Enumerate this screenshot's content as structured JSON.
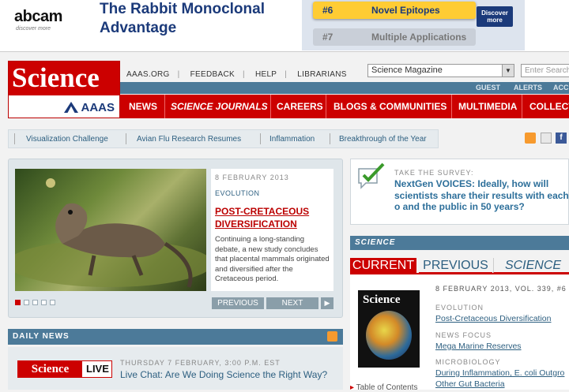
{
  "ad": {
    "brand": "abcam",
    "tagline": "discover more",
    "headline_line1": "The Rabbit Monoclonal",
    "headline_line2": "Advantage",
    "rows": [
      {
        "num": "#6",
        "text": "Novel Epitopes"
      },
      {
        "num": "#7",
        "text": "Multiple Applications"
      }
    ],
    "cta": "Discover more"
  },
  "header": {
    "logo_text": "Science",
    "aaas_text": "AAAS",
    "toplinks": [
      "AAAS.ORG",
      "FEEDBACK",
      "HELP",
      "LIBRARIANS"
    ],
    "select_value": "Science Magazine",
    "search_placeholder": "Enter Search",
    "userbar": [
      "GUEST",
      "ALERTS",
      "ACC"
    ]
  },
  "nav": [
    "NEWS",
    "SCIENCE JOURNALS",
    "CAREERS",
    "BLOGS & COMMUNITIES",
    "MULTIMEDIA",
    "COLLECT"
  ],
  "sublinks": [
    "Visualization Challenge",
    "Avian Flu Research Resumes",
    "Inflammation",
    "Breakthrough of the Year"
  ],
  "feature": {
    "date": "8 FEBRUARY 2013",
    "category": "EVOLUTION",
    "title": "POST-CRETACEOUS DIVERSIFICATION",
    "body": "Continuing a long-standing debate, a new study concludes that placental mammals originated and diversified after the Cretaceous period.",
    "prev": "PREVIOUS",
    "next": "NEXT"
  },
  "daily_news": {
    "header": "DAILY NEWS",
    "logo_science": "Science",
    "logo_live": "LIVE",
    "when": "THURSDAY 7 FEBRUARY, 3:00 P.M. EST",
    "title": "Live Chat: Are We Doing Science the Right Way?"
  },
  "survey": {
    "label": "TAKE THE SURVEY:",
    "text": "NextGen VOICES: Ideally, how will scientists share their results with each o and the public in 50 years?"
  },
  "science_section": {
    "header": "SCIENCE",
    "tabs": [
      "CURRENT ISSUE",
      "PREVIOUS ISSUES",
      "SCIENCE EXPRESS"
    ],
    "cover_title": "Science",
    "issue": "8 FEBRUARY 2013, VOL. 339, #6",
    "items": [
      {
        "section": "EVOLUTION",
        "link": "Post-Cretaceous Diversification"
      },
      {
        "section": "NEWS FOCUS",
        "link": "Mega Marine Reserves"
      },
      {
        "section": "MICROBIOLOGY",
        "link": "During Inflammation, E. coli Outgro",
        "link2": "Other Gut Bacteria"
      }
    ],
    "toc": "Table of Contents"
  },
  "colors": {
    "science_red": "#cc0000",
    "nav_blue": "#4c7a99",
    "link_blue": "#2d5f80"
  }
}
